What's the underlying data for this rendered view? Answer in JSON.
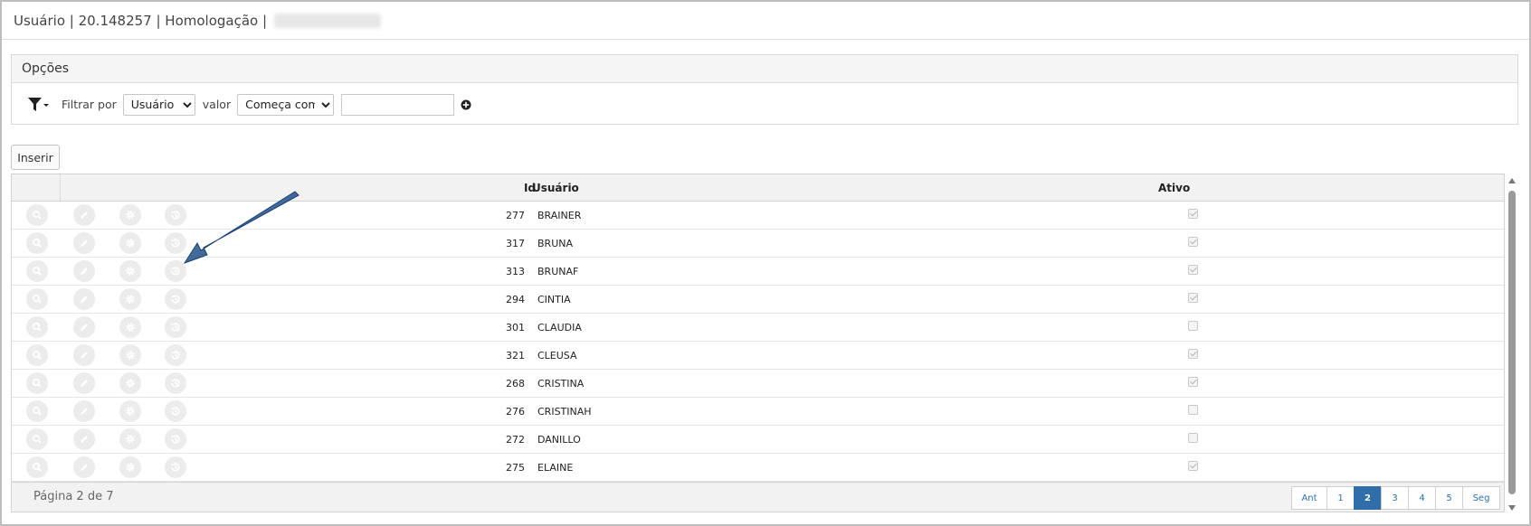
{
  "window": {
    "title": "Usuário | 20.148257 | Homologação |"
  },
  "options": {
    "header": "Opções",
    "filter_icon": "filter-dropdown-icon",
    "filter_by_label": "Filtrar por",
    "filter_field_value": "Usuário",
    "filter_field_options": [
      "Usuário"
    ],
    "value_label": "valor",
    "operator_value": "Começa com",
    "operator_options": [
      "Começa com"
    ],
    "search_value": "",
    "add_icon": "plus-circle-icon"
  },
  "toolbar": {
    "insert_label": "Inserir"
  },
  "table": {
    "columns": {
      "id": "Id",
      "user": "Usuário",
      "active": "Ativo"
    },
    "action_icons": [
      "search-icon",
      "pencil-icon",
      "gear-icon",
      "history-icon"
    ],
    "rows": [
      {
        "id": "277",
        "user": "BRAINER",
        "active": true
      },
      {
        "id": "317",
        "user": "BRUNA",
        "active": true
      },
      {
        "id": "313",
        "user": "BRUNAF",
        "active": true
      },
      {
        "id": "294",
        "user": "CINTIA",
        "active": true
      },
      {
        "id": "301",
        "user": "CLAUDIA",
        "active": false
      },
      {
        "id": "321",
        "user": "CLEUSA",
        "active": true
      },
      {
        "id": "268",
        "user": "CRISTINA",
        "active": true
      },
      {
        "id": "276",
        "user": "CRISTINAH",
        "active": false
      },
      {
        "id": "272",
        "user": "DANILLO",
        "active": false
      },
      {
        "id": "275",
        "user": "ELAINE",
        "active": true
      }
    ]
  },
  "pagination": {
    "info": "Página 2 de 7",
    "prev_label": "Ant",
    "next_label": "Seg",
    "pages": [
      "1",
      "2",
      "3",
      "4",
      "5"
    ],
    "current": "2"
  },
  "colors": {
    "accent": "#2f6ea8",
    "annotation_arrow": "#1e4f8a"
  }
}
